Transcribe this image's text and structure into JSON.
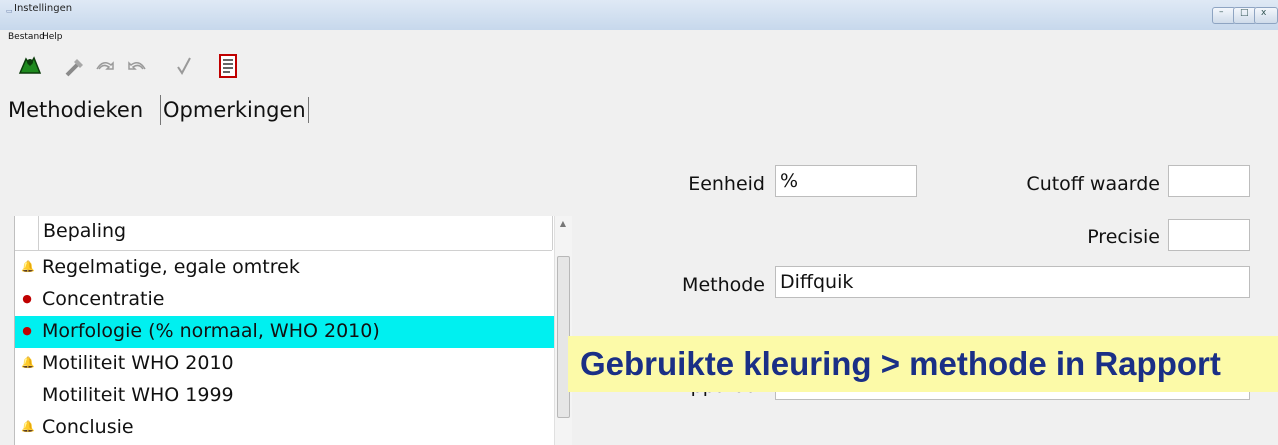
{
  "window": {
    "title": "Instellingen",
    "app_icon": "app-icon",
    "controls": {
      "minimize": "–",
      "maximize": "□",
      "close": "x"
    }
  },
  "menubar": {
    "items": [
      "Bestand",
      "Help"
    ]
  },
  "toolbar": {
    "icons": [
      "exit-icon",
      "wand-icon",
      "redo-icon",
      "undo-icon",
      "check-icon",
      "document-icon"
    ]
  },
  "tabs": [
    {
      "label": "Methodieken",
      "active": true
    },
    {
      "label": "Opmerkingen",
      "active": false
    }
  ],
  "list": {
    "header": "Bepaling",
    "rows": [
      {
        "label": "Regelmatige, egale omtrek",
        "icon": "bell-icon",
        "icon_color": "#a08a00",
        "selected": false
      },
      {
        "label": "Concentratie",
        "icon": "lock-icon",
        "icon_color": "#c00000",
        "selected": false
      },
      {
        "label": "Morfologie (% normaal, WHO 2010)",
        "icon": "lock-icon",
        "icon_color": "#c00000",
        "selected": true
      },
      {
        "label": "Motiliteit WHO 2010",
        "icon": "bell-icon",
        "icon_color": "#a08a00",
        "selected": false
      },
      {
        "label": "Motiliteit WHO 1999",
        "icon": "",
        "icon_color": "",
        "selected": false
      },
      {
        "label": "Conclusie",
        "icon": "bell-icon",
        "icon_color": "#a08a00",
        "selected": false
      }
    ]
  },
  "form": {
    "eenheid_label": "Eenheid",
    "eenheid_value": "%",
    "cutoff_label": "Cutoff waarde",
    "cutoff_value": "",
    "precisie_label": "Precisie",
    "precisie_value": "",
    "methode_label": "Methode",
    "methode_value": "Diffquik",
    "apparaat_label": "Apparaat",
    "apparaat_value": ""
  },
  "caption": {
    "text": "Gebruikte kleuring > methode in Rapport",
    "bg_color": "#fcfaa8",
    "text_color": "#1a2f86"
  },
  "colors": {
    "selection": "#00f0f0"
  }
}
